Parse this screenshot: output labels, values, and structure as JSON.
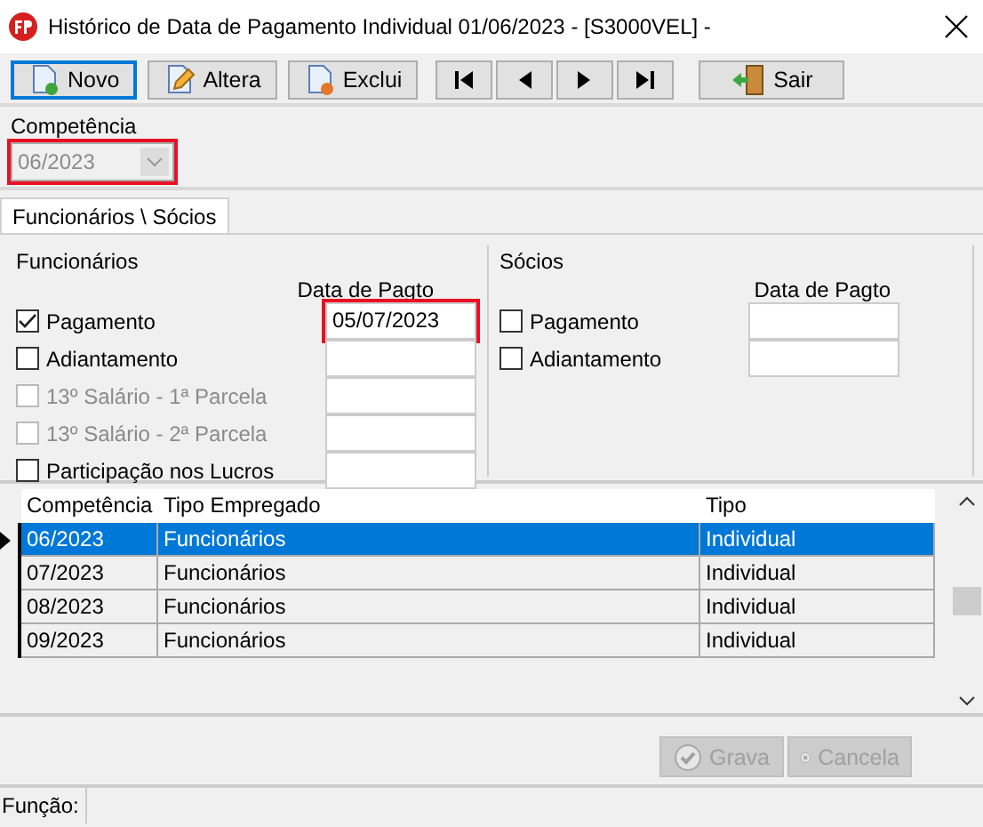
{
  "window": {
    "title": "Histórico de Data de Pagamento Individual  01/06/2023 - [S3000VEL] -"
  },
  "toolbar": [
    {
      "kind": "new",
      "label": "Novo",
      "focused": true
    },
    {
      "kind": "edit",
      "label": "Altera",
      "focused": false
    },
    {
      "kind": "delete",
      "label": "Exclui",
      "focused": false
    },
    {
      "kind": "first",
      "focused": false
    },
    {
      "kind": "prev",
      "focused": false
    },
    {
      "kind": "next",
      "focused": false
    },
    {
      "kind": "last",
      "focused": false
    },
    {
      "kind": "exit",
      "label": "Sair",
      "focused": false
    }
  ],
  "competencia": {
    "label": "Competência",
    "value": "06/2023",
    "disabled": true,
    "highlighted": true
  },
  "tabs": [
    {
      "label": "Funcionários \\ Sócios",
      "selected": true
    }
  ],
  "groups": [
    {
      "title": "Funcionários",
      "date_header": "Data de Pagto",
      "rows": [
        {
          "label": "Pagamento",
          "checked": true,
          "disabled": false,
          "date": "05/07/2023",
          "highlighted": true
        },
        {
          "label": "Adiantamento",
          "checked": false,
          "disabled": false,
          "highlighted": false
        },
        {
          "label": "13º Salário - 1ª Parcela",
          "checked": false,
          "disabled": true,
          "highlighted": false
        },
        {
          "label": "13º Salário - 2ª Parcela",
          "checked": false,
          "disabled": true,
          "highlighted": false
        },
        {
          "label": "Participação nos Lucros",
          "checked": false,
          "disabled": false,
          "highlighted": false
        }
      ]
    },
    {
      "title": "Sócios",
      "date_header": "Data de Pagto",
      "rows": [
        {
          "label": "Pagamento",
          "checked": false,
          "disabled": false,
          "highlighted": false
        },
        {
          "label": "Adiantamento",
          "checked": false,
          "disabled": false,
          "highlighted": false
        }
      ]
    }
  ],
  "table": {
    "columns": [
      "Competência",
      "Tipo Empregado",
      "Tipo"
    ],
    "rows": [
      {
        "cells": [
          "06/2023",
          "Funcionários",
          "Individual"
        ],
        "selected": true
      },
      {
        "cells": [
          "07/2023",
          "Funcionários",
          "Individual"
        ],
        "selected": false
      },
      {
        "cells": [
          "08/2023",
          "Funcionários",
          "Individual"
        ],
        "selected": false
      },
      {
        "cells": [
          "09/2023",
          "Funcionários",
          "Individual"
        ],
        "selected": false
      }
    ]
  },
  "actions": [
    {
      "kind": "save",
      "label": "Grava",
      "disabled": true
    },
    {
      "kind": "cancel",
      "label": "Cancela",
      "disabled": true
    }
  ],
  "status_bar": {
    "label": "Função:"
  }
}
